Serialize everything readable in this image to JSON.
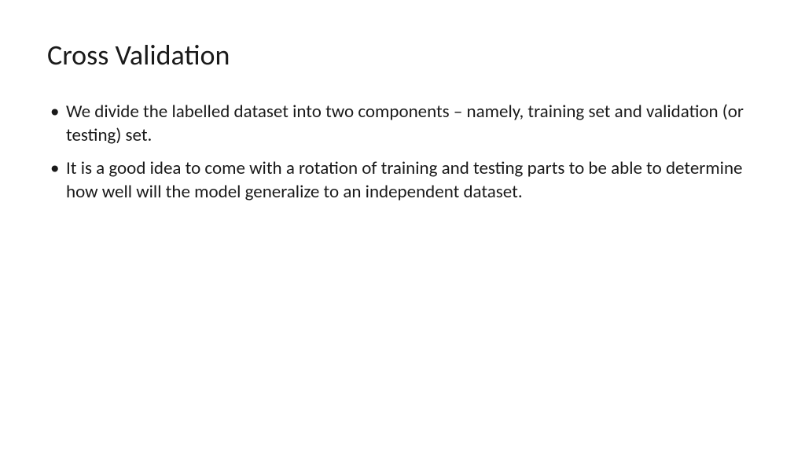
{
  "slide": {
    "title": "Cross Validation",
    "bullets": [
      "We divide the labelled dataset into two components – namely, training set and validation (or testing) set.",
      "It is a good idea to come with a rotation of training and testing parts to be able to determine how well will the model generalize to an independent dataset."
    ]
  }
}
